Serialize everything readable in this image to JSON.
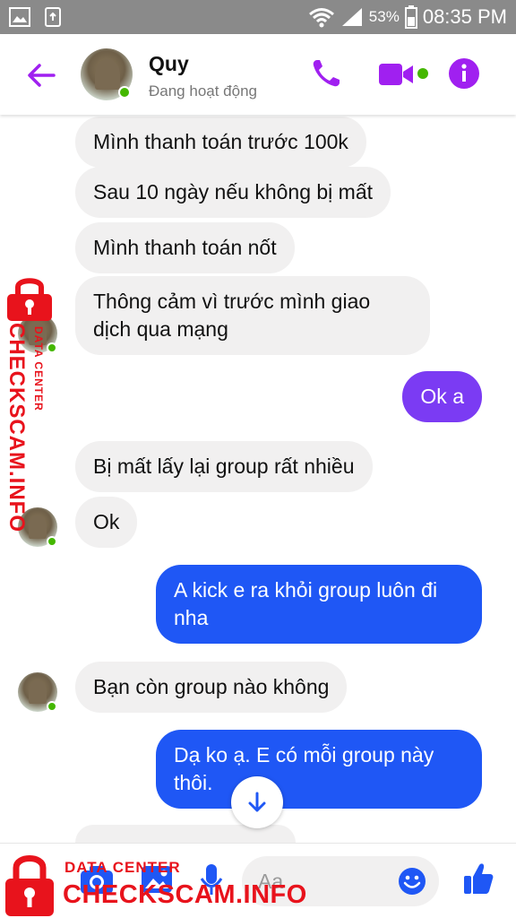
{
  "status_bar": {
    "battery_percent": "53%",
    "time": "08:35 PM"
  },
  "header": {
    "contact_name": "Quy",
    "presence": "Đang hoạt động"
  },
  "messages": [
    {
      "side": "in",
      "text": "Mình thanh toán trước 100k"
    },
    {
      "side": "in",
      "text": "Sau 10 ngày nếu không bị mất"
    },
    {
      "side": "in",
      "text": "Mình thanh toán nốt"
    },
    {
      "side": "in",
      "text": "Thông cảm vì trước mình giao dịch qua mạng"
    },
    {
      "side": "out",
      "text": "Ok a"
    },
    {
      "side": "in",
      "text": "Bị mất lấy lại group rất nhiều"
    },
    {
      "side": "in",
      "text": "Ok"
    },
    {
      "side": "out",
      "text": "A kick e ra khỏi group luôn đi nha"
    },
    {
      "side": "in",
      "text": "Bạn còn group nào không"
    },
    {
      "side": "out",
      "text": "Dạ ko ạ. E có mỗi group này thôi."
    }
  ],
  "composer": {
    "placeholder": "Aa"
  },
  "watermark": {
    "small_text": "DATA CENTER",
    "big_text": "CHECKSCAM.INFO"
  },
  "colors": {
    "accent": "#a020f0",
    "outgoing_purple": "#7b3bf3",
    "outgoing_blue": "#1f57f5",
    "incoming": "#f1f0f0",
    "online": "#44b700",
    "watermark": "#e8131c"
  },
  "icons": [
    "image-icon",
    "recycle-icon",
    "wifi-icon",
    "signal-icon",
    "battery-icon",
    "back-arrow-icon",
    "phone-icon",
    "video-camera-icon",
    "info-icon",
    "arrow-down-icon",
    "camera-icon",
    "gallery-icon",
    "microphone-icon",
    "emoji-icon",
    "thumbs-up-icon",
    "padlock-icon"
  ]
}
